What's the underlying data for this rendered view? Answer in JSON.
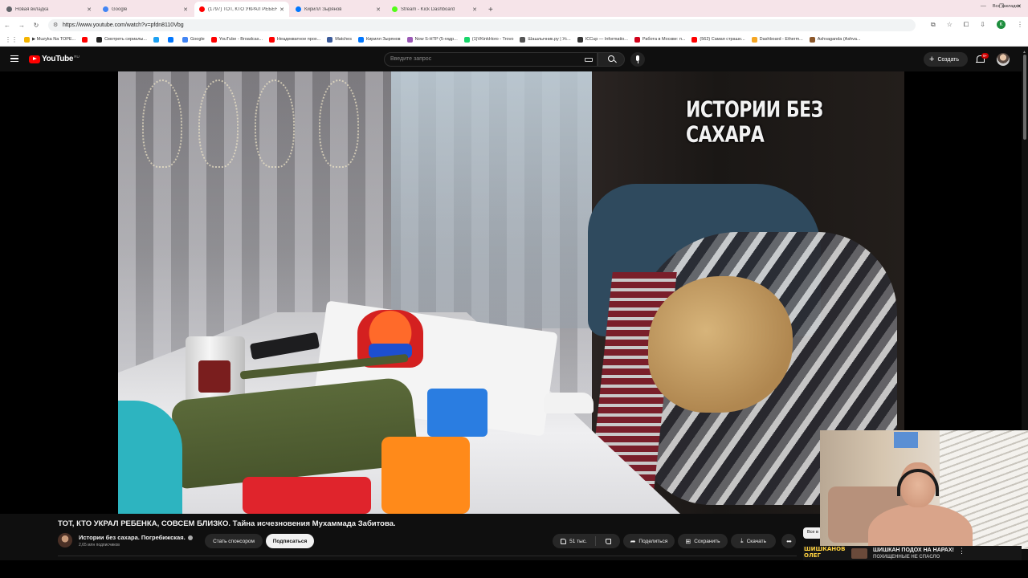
{
  "browser": {
    "tabs": [
      {
        "title": "Новая вкладка",
        "color": "#5f6368",
        "active": false
      },
      {
        "title": "Google",
        "color": "#4285f4",
        "active": false
      },
      {
        "title": "(1797) ТОТ, КТО УКРАЛ РЕБЕН...",
        "color": "#ff0000",
        "active": true
      },
      {
        "title": "Кирилл Зырянов",
        "color": "#0077ff",
        "active": false
      },
      {
        "title": "Stream - Kick Dashboard",
        "color": "#53fc18",
        "active": false
      }
    ],
    "url": "https://www.youtube.com/watch?v=pfdn8110Vbg",
    "profile_initial": "K",
    "bookmarks": [
      {
        "label": "▶ Muzyka Na TOPE...",
        "color": "#f4b400"
      },
      {
        "label": "",
        "color": "#ff0000"
      },
      {
        "label": "Смотреть сериалы...",
        "color": "#222222"
      },
      {
        "label": "",
        "color": "#1da1f2"
      },
      {
        "label": "",
        "color": "#0077ff"
      },
      {
        "label": "Google",
        "color": "#4285f4"
      },
      {
        "label": "YouTube - Broadcas...",
        "color": "#ff0000"
      },
      {
        "label": "Неадекватное прох...",
        "color": "#ff0000"
      },
      {
        "label": "Matches",
        "color": "#3b5b9a"
      },
      {
        "label": "Кирилл Зырянов",
        "color": "#0077ff"
      },
      {
        "label": "Now S-HTP (5-гидр...",
        "color": "#9b59b6"
      },
      {
        "label": "(1)VKinkHoro - Trovo",
        "color": "#19d66b"
      },
      {
        "label": "Шашлычник.ру | Ус...",
        "color": "#555555"
      },
      {
        "label": "ICCup — Informatio...",
        "color": "#333333"
      },
      {
        "label": "Работа в Москве: п...",
        "color": "#d0021b"
      },
      {
        "label": "(562) Самая страшн...",
        "color": "#ff0000"
      },
      {
        "label": "Dashboard - Etherm...",
        "color": "#f5a623"
      },
      {
        "label": "Ashvaganda (Ashva...",
        "color": "#8b572a"
      }
    ],
    "all_bookmarks": "Все закладки"
  },
  "youtube": {
    "logo_text": "YouTube",
    "region": "RU",
    "search_placeholder": "Введите запрос",
    "create_label": "Создать",
    "notif_badge": "9+"
  },
  "video": {
    "overlay_text": "ИСТОРИИ БЕЗ САХАРА",
    "title": "ТОТ, КТО УКРАЛ РЕБЕНКА, СОВСЕМ БЛИЗКО. Тайна исчезновения Мухаммада Забитова.",
    "channel_name": "Истории без сахара. Погребижская.",
    "subscribers": "2,65 млн подписчиков",
    "sponsor_label": "Стать спонсором",
    "subscribe_label": "Подписаться",
    "likes": "51 тыс.",
    "share_label": "Поделиться",
    "save_label": "Сохранить",
    "download_label": "Скачать",
    "all_label": "Все в"
  },
  "stream_overlay": {
    "name_label": "ШИШКАНОВ\nОЛЕГ",
    "message": "ШИШКАН ПОДОХ НА НАРАХ!",
    "message_sub": "ПОХИЩЕННЫЕ НЕ СПАСЛО"
  }
}
